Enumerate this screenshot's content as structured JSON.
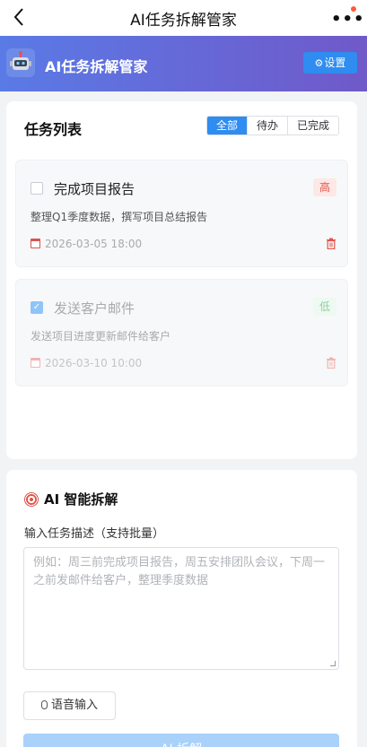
{
  "topbar": {
    "title": "AI任务拆解管家",
    "more": "•••"
  },
  "header": {
    "icon": "robot-icon",
    "title": "AI任务拆解管家",
    "settings_icon": "gear-icon",
    "settings_label": "设置"
  },
  "tasks_card": {
    "title": "任务列表",
    "filters": [
      "全部",
      "待办",
      "已完成"
    ],
    "active_filter": "全部",
    "tasks": [
      {
        "title": "完成项目报告",
        "priority": "高",
        "description": "整理Q1季度数据，撰写项目总结报告",
        "date": "2026-03-05 18:00",
        "completed": false
      },
      {
        "title": "发送客户邮件",
        "priority": "低",
        "description": "发送项目进度更新邮件给客户",
        "date": "2026-03-10 10:00",
        "completed": true
      }
    ]
  },
  "ai_card": {
    "title": "AI 智能拆解",
    "input_label": "输入任务描述（支持批量）",
    "placeholder": "例如：周三前完成项目报告，周五安排团队会议，下周一之前发邮件给客户，整理季度数据",
    "voice_label": "语音输入",
    "submit_label": "AI 拆解"
  },
  "colors": {
    "accent": "#2f8cf0",
    "header_from": "#5a7ae6",
    "header_to": "#7059c9",
    "high": "#e2554a",
    "low": "#52b56a"
  }
}
